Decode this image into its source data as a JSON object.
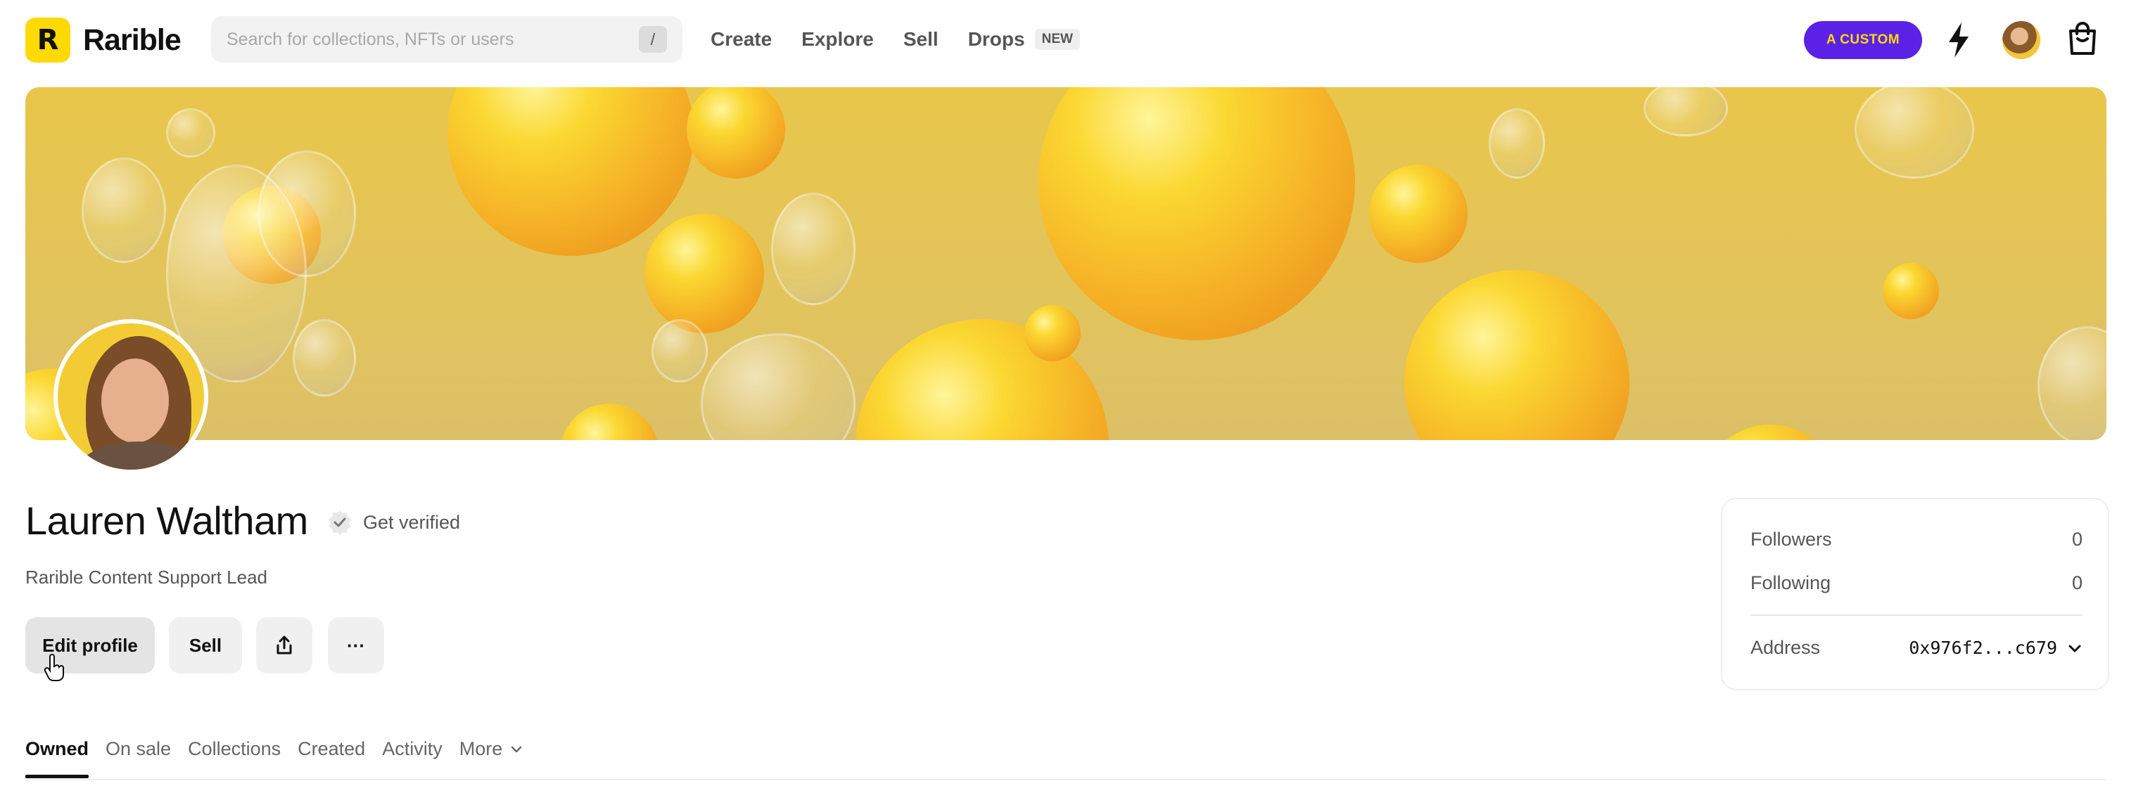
{
  "header": {
    "logo_mark": "R",
    "brand": "Rarible",
    "search": {
      "placeholder": "Search for collections, NFTs or users",
      "shortcut": "/"
    },
    "nav": [
      {
        "label": "Create"
      },
      {
        "label": "Explore"
      },
      {
        "label": "Sell"
      },
      {
        "label": "Drops",
        "badge": "NEW"
      }
    ],
    "custom_button": "A CUSTOM",
    "icons": {
      "bolt": "bolt-icon",
      "avatar": "user-avatar",
      "bag": "shopping-bag-icon"
    }
  },
  "colors": {
    "brand_yellow": "#FEDA03",
    "custom_purple": "#5B21E6",
    "banner": "#E6C552"
  },
  "profile": {
    "name": "Lauren Waltham",
    "get_verified": "Get verified",
    "bio": "Rarible Content Support Lead",
    "actions": {
      "edit": "Edit profile",
      "sell": "Sell",
      "more": "···"
    }
  },
  "stats": {
    "followers_label": "Followers",
    "followers_value": "0",
    "following_label": "Following",
    "following_value": "0",
    "address_label": "Address",
    "address_value": "0x976f2...c679"
  },
  "tabs": [
    {
      "label": "Owned",
      "active": true
    },
    {
      "label": "On sale"
    },
    {
      "label": "Collections"
    },
    {
      "label": "Created"
    },
    {
      "label": "Activity"
    },
    {
      "label": "More"
    }
  ]
}
